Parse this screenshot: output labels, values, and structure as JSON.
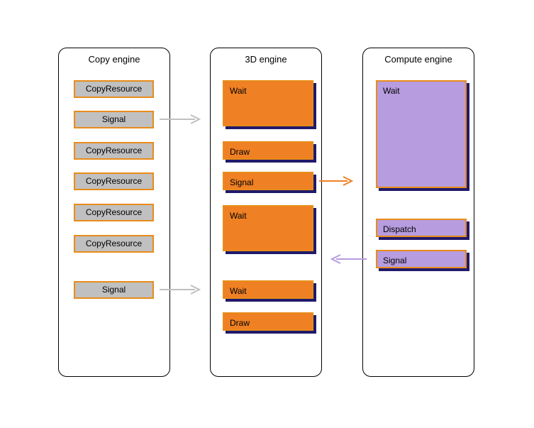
{
  "engines": {
    "copy": {
      "title": "Copy engine",
      "blocks": [
        "CopyResource",
        "Signal",
        "CopyResource",
        "CopyResource",
        "CopyResource",
        "CopyResource",
        "Signal"
      ]
    },
    "d3": {
      "title": "3D engine",
      "blocks": [
        "Wait",
        "Draw",
        "Signal",
        "Wait",
        "Wait",
        "Draw"
      ]
    },
    "compute": {
      "title": "Compute engine",
      "blocks": [
        "Wait",
        "Dispatch",
        "Signal"
      ]
    }
  }
}
